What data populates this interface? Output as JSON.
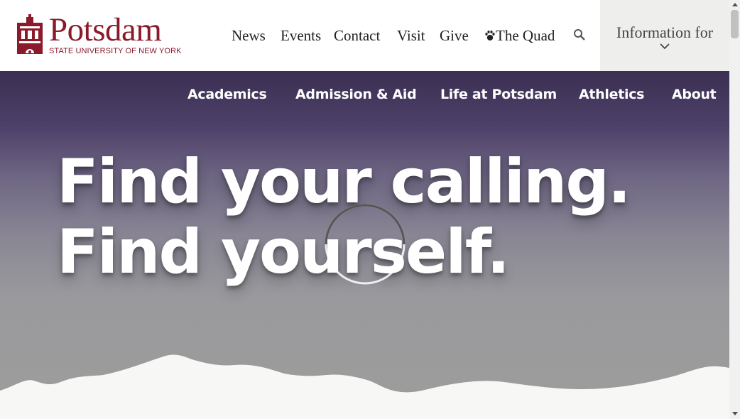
{
  "header": {
    "logo": {
      "wordmark": "Potsdam",
      "subtitle": "STATE UNIVERSITY OF NEW YORK",
      "icon": "bell-tower-icon"
    },
    "utility_nav": [
      "News",
      "Events",
      "Contact",
      "Visit",
      "Give"
    ],
    "quad_link": {
      "label": "The Quad",
      "icon": "paw-icon"
    },
    "search_icon": "search-icon",
    "info_for": {
      "label": "Information for",
      "icon": "chevron-down-icon"
    }
  },
  "main_nav": [
    "Academics",
    "Admission & Aid",
    "Life at Potsdam",
    "Athletics",
    "About"
  ],
  "hero": {
    "headline_line1": "Find your calling.",
    "headline_line2": "Find yourself.",
    "loading_icon": "spinner-icon"
  },
  "colors": {
    "brand": "#8b1a2b",
    "info_bg": "#eeefed",
    "hero_top": "#3b3052",
    "hero_bottom": "#9d9d9d",
    "snow": "#f7f7f6"
  }
}
